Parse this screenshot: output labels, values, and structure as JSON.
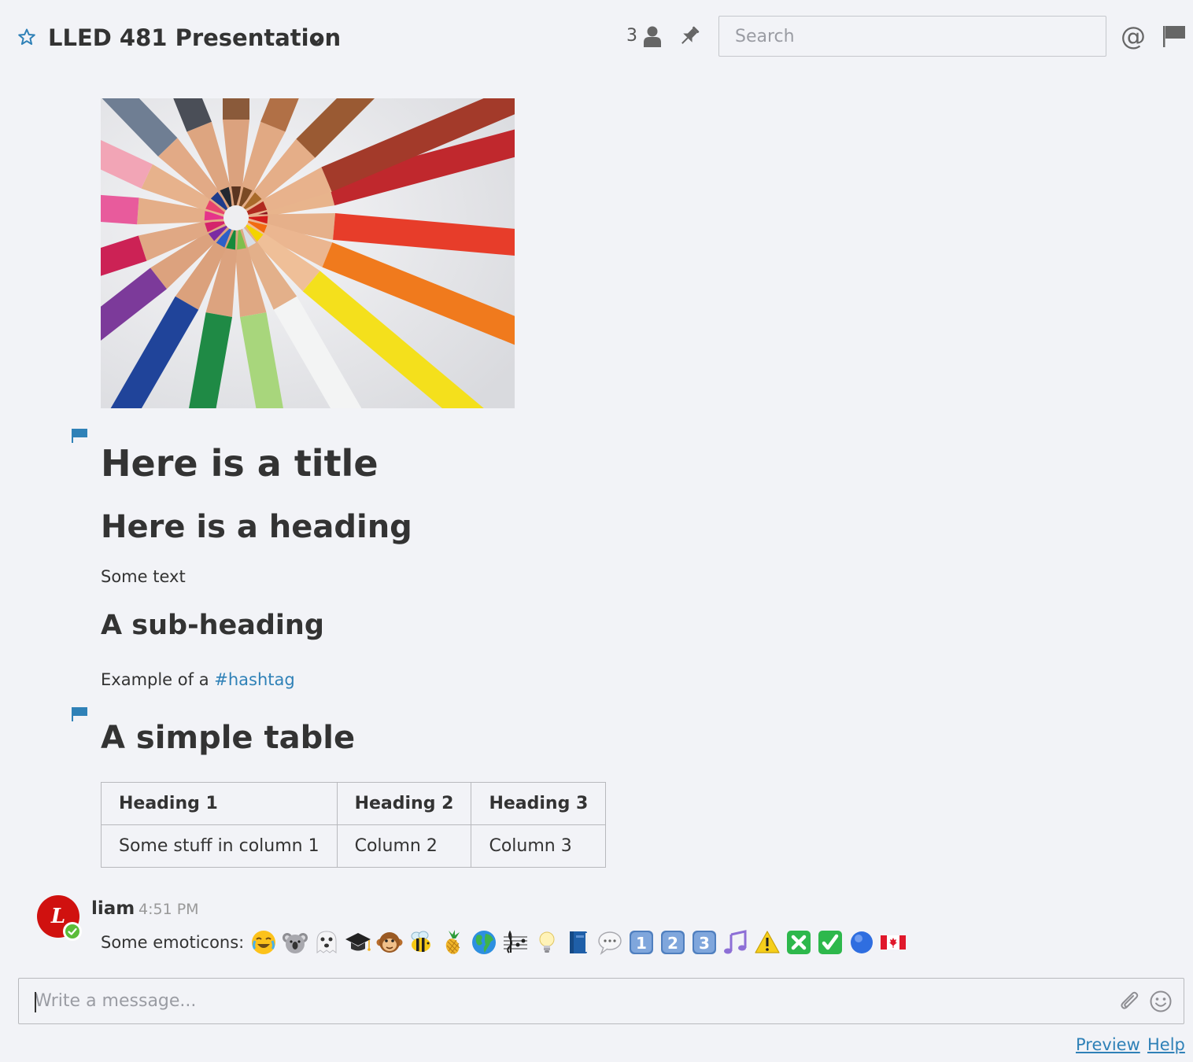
{
  "header": {
    "channel_name": "LLED 481 Presentation",
    "member_count": "3",
    "search_placeholder": "Search",
    "mention_symbol": "@"
  },
  "post": {
    "title": "Here is a title",
    "heading": "Here is a heading",
    "text": "Some text",
    "subheading": "A sub-heading",
    "hashtag_prefix": "Example of a ",
    "hashtag": "#hashtag",
    "table_title": "A simple table",
    "table": {
      "headers": [
        "Heading 1",
        "Heading 2",
        "Heading 3"
      ],
      "rows": [
        [
          "Some stuff in column 1",
          "Column 2",
          "Column 3"
        ]
      ]
    }
  },
  "message": {
    "avatar_letter": "L",
    "username": "liam",
    "timestamp": "4:51 PM",
    "text": "Some emoticons:",
    "emoticons": [
      "joy-emoji",
      "koala-emoji",
      "ghost-emoji",
      "graduation-cap-emoji",
      "monkey-emoji",
      "bee-emoji",
      "pineapple-emoji",
      "globe-emoji",
      "musical-score-emoji",
      "light-bulb-emoji",
      "blue-book-emoji",
      "speech-balloon-emoji",
      "keycap-1-emoji",
      "keycap-2-emoji",
      "keycap-3-emoji",
      "musical-note-emoji",
      "warning-emoji",
      "cross-mark-emoji",
      "check-mark-emoji",
      "blue-circle-emoji",
      "canada-flag-emoji"
    ]
  },
  "composer": {
    "placeholder": "Write a message...",
    "preview_label": "Preview",
    "help_label": "Help"
  },
  "colors": {
    "background": "#f2f3f7",
    "text": "#333333",
    "link": "#2f81b7",
    "avatar": "#d0110f",
    "online": "#5cbc3a"
  }
}
